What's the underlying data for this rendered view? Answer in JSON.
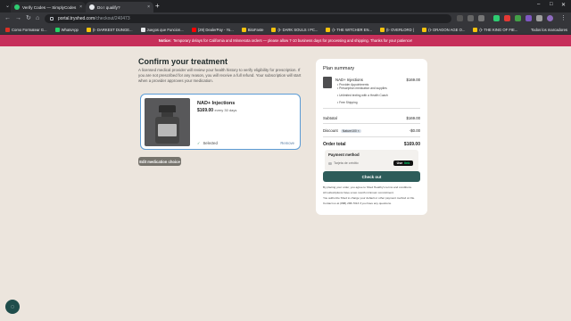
{
  "browser": {
    "tabs": [
      {
        "title": "Verify Codes — SimplyCodes",
        "close": "×"
      },
      {
        "title": "Do I qualify?",
        "close": "×"
      }
    ],
    "new_tab": "+",
    "url_host": "portal.tryshed.com",
    "url_path": "/checkout/240473",
    "bookmarks": [
      {
        "label": "Como Formatear G...",
        "color": "#d93025"
      },
      {
        "label": "WhatsApp",
        "color": "#25d366"
      },
      {
        "label": "(t- DARKEST DUNGE...",
        "color": "#f4c20d"
      },
      {
        "label": "Juegos que Funcion...",
        "color": "#e8eaed"
      },
      {
        "label": "(29) DealerPay - Yo...",
        "color": "#ff0000"
      },
      {
        "label": "BitoFaste",
        "color": "#f4c20d"
      },
      {
        "label": "(t- DARK SOULS I PC...",
        "color": "#f4c20d"
      },
      {
        "label": "(t- THE WITCHER EN...",
        "color": "#f4c20d"
      },
      {
        "label": "(t- OVERLORD (",
        "color": "#f4c20d"
      },
      {
        "label": "(t- DRAGON AGE O...",
        "color": "#f4c20d"
      },
      {
        "label": "(t- THE KING OF FIE...",
        "color": "#f4c20d"
      }
    ],
    "all_bookmarks": "Todos los marcadores"
  },
  "banner": {
    "strong": "Notice:",
    "text": "Temporary delays for California and Minnesota orders — please allow 7-10 business days for processing and shipping. Thanks for your patience!"
  },
  "main": {
    "title": "Confirm your treatment",
    "intro": "A licensed medical provider will review your health history to verify eligibility for prescription. If you are not prescribed for any reason, you will receive a full refund. Your subscription will start when a provider approves your medication.",
    "product": {
      "name": "NAD+ Injections",
      "price": "$169.00",
      "period": "every 30 days",
      "selected": "Selected",
      "remove": "Remove"
    },
    "edit_button": "Edit medication choice"
  },
  "summary": {
    "title": "Plan summary",
    "item_name": "NAD+ Injections",
    "item_price": "$169.00",
    "features": [
      "Provider Appointments",
      "Prescription medication and supplies",
      "Unlimited texting with a Health Coach",
      "Free Shipping"
    ],
    "subtotal_label": "Subtotal",
    "subtotal": "$169.00",
    "discount_label": "Discount",
    "discount_code": "Nature100 ×",
    "discount": "-$0.00",
    "total_label": "Order total",
    "total": "$169.00",
    "payment_label": "Payment method",
    "card_text": "Tarjeta de crédito",
    "link_label": "Use",
    "link_brand": "link",
    "checkout": "Check out",
    "legal1": "By placing your order, you agree to Shed Healthy's terms and conditions.",
    "legal2": "All subscriptions have a two month minimum commitment.",
    "legal3": "You authorize Shed to charge your default or other payment method on file.",
    "legal4": "Contact us at (888) 288-7013 if you have any questions."
  },
  "chat_icon": "chat-icon"
}
